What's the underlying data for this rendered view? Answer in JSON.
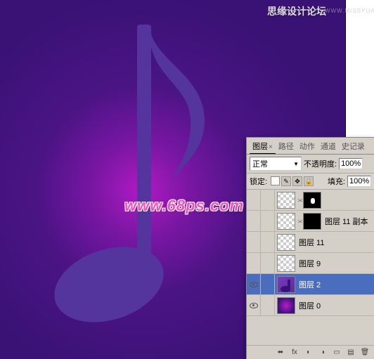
{
  "watermarks": {
    "top_text": "思缘设计论坛",
    "top_url": "WWW.MISSYUAN.COM",
    "center": "www.68ps.com"
  },
  "panel": {
    "tabs": {
      "layers": "图层",
      "x": "×",
      "paths": "路径",
      "actions": "动作",
      "channels": "通道",
      "history": "史记录"
    },
    "blend": {
      "mode": "正常",
      "opacity_label": "不透明度:",
      "opacity_value": "100%"
    },
    "lock": {
      "label": "锁定:",
      "fill_label": "填充:",
      "fill_value": "100%"
    },
    "layers": [
      {
        "name": ""
      },
      {
        "name": "图层 11 副本"
      },
      {
        "name": "图层 11"
      },
      {
        "name": "图层 9"
      },
      {
        "name": "图层 2"
      },
      {
        "name": "图层 0"
      }
    ],
    "footer": {
      "link": "⬌",
      "fx": "fx",
      "mask": "◐",
      "adjust": "◑",
      "folder": "▭",
      "new": "▤",
      "trash": "🗑"
    }
  }
}
